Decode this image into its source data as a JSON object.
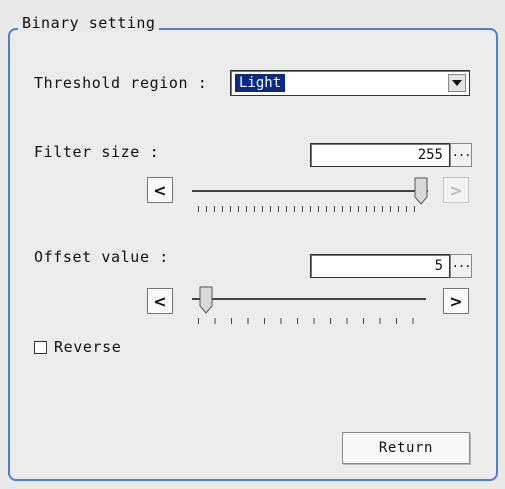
{
  "panel": {
    "title": "Binary setting",
    "threshold_region": {
      "label": "Threshold region :",
      "selected": "Light"
    },
    "filter_size": {
      "label": "Filter size :",
      "value": "255",
      "more_label": "...",
      "slider_level": 1.0,
      "left_arrow": "<",
      "right_arrow": ">"
    },
    "offset_value": {
      "label": "Offset value :",
      "value": "5",
      "more_label": "...",
      "slider_level": 0.03,
      "left_arrow": "<",
      "right_arrow": ">"
    },
    "reverse": {
      "label": "Reverse",
      "checked": false
    },
    "return_label": "Return"
  }
}
